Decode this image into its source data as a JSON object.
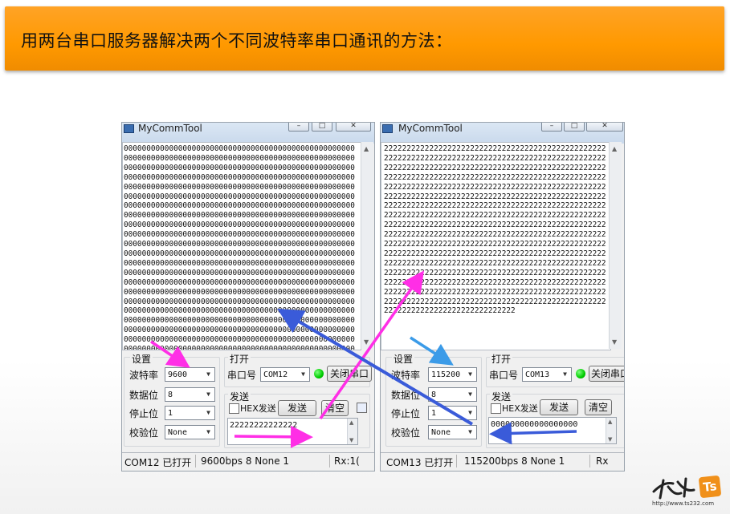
{
  "banner": {
    "title": "用两台串口服务器解决两个不同波特率串口通讯的方法："
  },
  "left_window": {
    "title": "MyCommTool",
    "rx_text": "000000000000000000000000000000000000000000000000000000000000000000000000000000000000000000000000000000000000000000000000000000000000000000000000000000000000000000000000000000000000000000000000000000000000000000000000000000000000000000000000000000000000000000000000000000000000000000000000000000000000000000000000000000000000000000000000000000000000000000000000000000000000000000000000000000000000000000000000000000000000000000000000000000000000000000000000000000000000000000000000000000000000000000000000000000000000000000000000000000000000000000000000000000000000000000000000000000000000000000000000000000000000000000000000000000000000000000000000000000000000000000000000000000000000000000000000000000000000000000000000000000000000000000000000000000000000000000000000000000000000000000000000000000000000000000000000000000000000000000000000000000000000000000000000000000000000000000000000000000000000000000000000000000000000000000000000000000000000000000000000000000000000000000000000000000000000000000000000000000000000000000000000000000000000000000000000000000000000000000000000000000000000000000000000000000000000000000000000000000000000000000000000000000000000000000000000000000000000000000000000000000000000000000000000000000000000000000000000",
    "settings_label": "设置",
    "baud_label": "波特率",
    "baud_value": "9600",
    "databits_label": "数据位",
    "databits_value": "8",
    "stopbits_label": "停止位",
    "stopbits_value": "1",
    "parity_label": "校验位",
    "parity_value": "None",
    "open_label": "打开",
    "port_label": "串口号",
    "port_value": "COM12",
    "close_button": "关闭串口",
    "send_label": "发送",
    "hex_label": "HEX发送",
    "send_button": "发送",
    "clear_button": "清空",
    "tx_value": "22222222222222",
    "status_port": "COM12 已打开",
    "status_params": "9600bps  8  None  1",
    "status_rx": "Rx:1("
  },
  "right_window": {
    "title": "MyCommTool",
    "rx_text": "2222222222222222222222222222222222222222222222222222222222222222222222222222222222222222222222222222222222222222222222222222222222222222222222222222222222222222222222222222222222222222222222222222222222222222222222222222222222222222222222222222222222222222222222222222222222222222222222222222222222222222222222222222222222222222222222222222222222222222222222222222222222222222222222222222222222222222222222222222222222222222222222222222222222222222222222222222222222222222222222222222222222222222222222222222222222222222222222222222222222222222222222222222222222222222222222222222222222222222222222222222222222222222222222222222222222222222222222222222222222222222222222222222222222222222222222222222222222222222222222222222222222222222222222222222222222222222222222222222222222222222222222222222222222222222222222222222222222222222222222222222222222222222222222",
    "settings_label": "设置",
    "baud_label": "波特率",
    "baud_value": "115200",
    "databits_label": "数据位",
    "databits_value": "8",
    "stopbits_label": "停止位",
    "stopbits_value": "1",
    "parity_label": "校验位",
    "parity_value": "None",
    "open_label": "打开",
    "port_label": "串口号",
    "port_value": "COM13",
    "close_button": "关闭串口",
    "send_label": "发送",
    "hex_label": "HEX发送",
    "send_button": "发送",
    "clear_button": "清空",
    "tx_value": "000000000000000000",
    "status_port": "COM13 已打开",
    "status_params": "115200bps  8  None  1",
    "status_rx": "Rx"
  },
  "logo": {
    "url": "http://www.ts232.com",
    "mark": "Ts",
    "brand": "天嵘"
  },
  "colors": {
    "banner": "#ff9900",
    "arrow_magenta": "#ff2ee6",
    "arrow_blue": "#3a5bd9",
    "arrow_cyan": "#3b9be8",
    "led": "#00cc00"
  }
}
